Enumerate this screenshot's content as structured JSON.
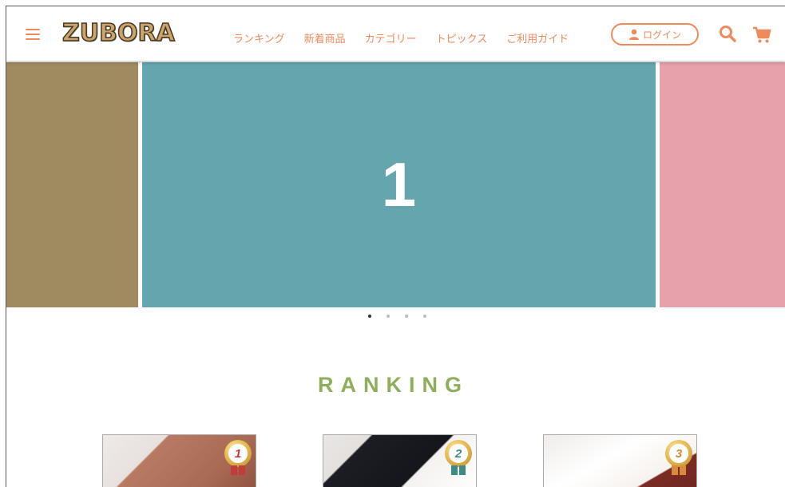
{
  "header": {
    "logo": "ZUBORA",
    "nav": [
      "ランキング",
      "新着商品",
      "カテゴリー",
      "トピックス",
      "ご利用ガイド"
    ],
    "login_label": "ログイン"
  },
  "slider": {
    "current_label": "1",
    "dots_count": 4,
    "active_dot": 1,
    "colors": {
      "left": "#a08a60",
      "center": "#64a5ae",
      "right": "#e6a1aa"
    }
  },
  "ranking": {
    "title": "RANKING",
    "items": [
      {
        "rank": "1",
        "color": "#c23c3c"
      },
      {
        "rank": "2",
        "color": "#3a8c84"
      },
      {
        "rank": "3",
        "color": "#d98a3a"
      }
    ]
  },
  "colors": {
    "accent": "#ee8a5c",
    "ranking_title": "#8fae5b"
  }
}
